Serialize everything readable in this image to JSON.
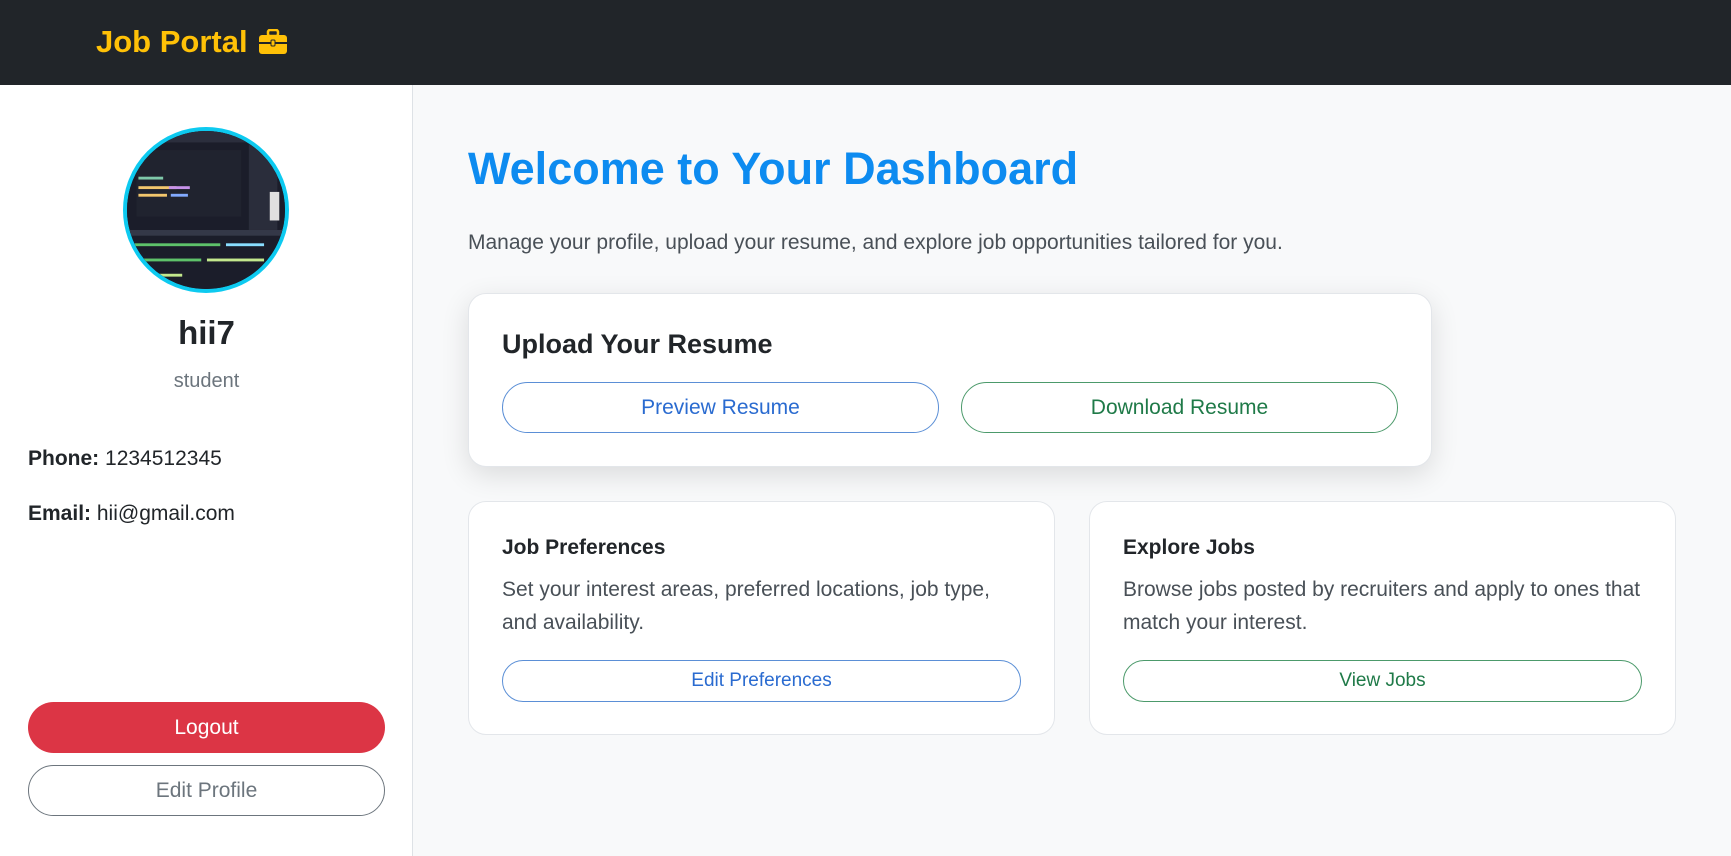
{
  "navbar": {
    "brand": "Job Portal",
    "brand_icon": "briefcase-icon",
    "brand_color": "#ffc107",
    "background": "#212529"
  },
  "sidebar": {
    "username": "hii7",
    "role": "student",
    "phone_label": "Phone:",
    "phone_value": "1234512345",
    "email_label": "Email:",
    "email_value": "hii@gmail.com",
    "logout_label": "Logout",
    "edit_profile_label": "Edit Profile"
  },
  "main": {
    "title": "Welcome to Your Dashboard",
    "description": "Manage your profile, upload your resume, and explore job opportunities tailored for you.",
    "resume_card": {
      "title": "Upload Your Resume",
      "preview_label": "Preview Resume",
      "download_label": "Download Resume"
    },
    "preferences_card": {
      "title": "Job Preferences",
      "text": "Set your interest areas, preferred locations, job type, and availability.",
      "button_label": "Edit Preferences"
    },
    "jobs_card": {
      "title": "Explore Jobs",
      "text": "Browse jobs posted by recruiters and apply to ones that match your interest.",
      "button_label": "View Jobs"
    }
  },
  "colors": {
    "title_blue": "#0d8bf0",
    "logout_red": "#dc3545",
    "avatar_border": "#0dcaf0"
  }
}
